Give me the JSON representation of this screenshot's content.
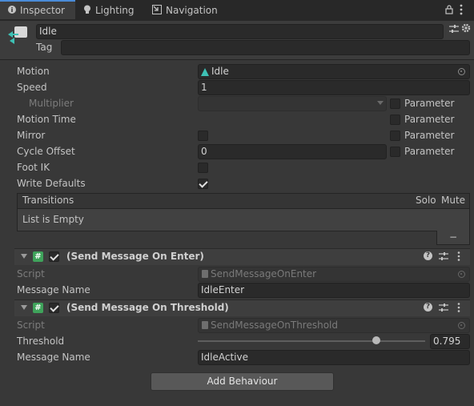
{
  "tabs": [
    {
      "label": "Inspector",
      "icon": "info-icon"
    },
    {
      "label": "Lighting",
      "icon": "lightbulb-icon"
    },
    {
      "label": "Navigation",
      "icon": "navigation-icon"
    }
  ],
  "header": {
    "name": "Idle",
    "tag_label": "Tag",
    "tag_value": ""
  },
  "props": {
    "motion_label": "Motion",
    "motion_value": "Idle",
    "speed_label": "Speed",
    "speed_value": "1",
    "multiplier_label": "Multiplier",
    "multiplier_value": "",
    "motion_time_label": "Motion Time",
    "mirror_label": "Mirror",
    "cycle_offset_label": "Cycle Offset",
    "cycle_offset_value": "0",
    "foot_ik_label": "Foot IK",
    "write_defaults_label": "Write Defaults",
    "parameter_label": "Parameter"
  },
  "transitions": {
    "title": "Transitions",
    "solo": "Solo",
    "mute": "Mute",
    "empty": "List is Empty",
    "remove": "−"
  },
  "behaviours": [
    {
      "title": "(Send Message On Enter)",
      "script_label": "Script",
      "script_value": "SendMessageOnEnter",
      "message_label": "Message Name",
      "message_value": "IdleEnter"
    },
    {
      "title": "(Send Message On Threshold)",
      "script_label": "Script",
      "script_value": "SendMessageOnThreshold",
      "threshold_label": "Threshold",
      "threshold_value": "0.795",
      "threshold_fraction": 0.795,
      "message_label": "Message Name",
      "message_value": "IdleActive"
    }
  ],
  "add_behaviour": "Add Behaviour",
  "colors": {
    "accent": "#4a8bd8",
    "script_icon": "#3fa35b",
    "motion_icon": "#3ec1b5"
  }
}
